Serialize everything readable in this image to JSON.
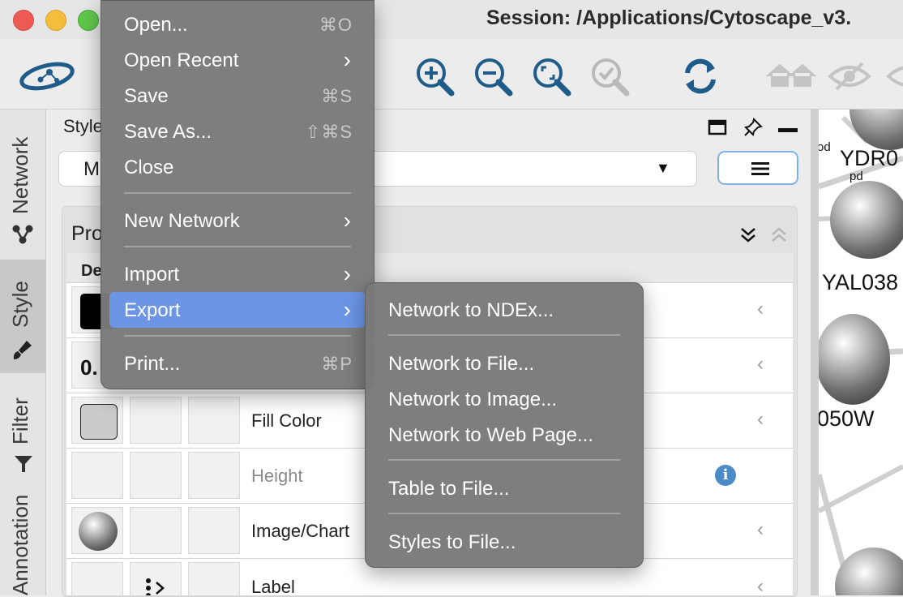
{
  "window": {
    "title": "Session: /Applications/Cytoscape_v3."
  },
  "file_menu": {
    "items": [
      {
        "label": "Open...",
        "shortcut": "⌘O"
      },
      {
        "label": "Open Recent",
        "submenu": true
      },
      {
        "label": "Save",
        "shortcut": "⌘S"
      },
      {
        "label": "Save As...",
        "shortcut": "⇧⌘S"
      },
      {
        "label": "Close"
      },
      {
        "label": "New Network",
        "submenu": true
      },
      {
        "label": "Import",
        "submenu": true
      },
      {
        "label": "Export",
        "submenu": true,
        "highlighted": true
      },
      {
        "label": "Print...",
        "shortcut": "⌘P"
      }
    ],
    "arrow_glyph": "›"
  },
  "export_submenu": {
    "items": [
      {
        "label": "Network to NDEx..."
      },
      {
        "label": "Network to File..."
      },
      {
        "label": "Network to Image..."
      },
      {
        "label": "Network to Web Page..."
      },
      {
        "label": "Table to File..."
      },
      {
        "label": "Styles to File..."
      }
    ]
  },
  "left_tabs": [
    {
      "label": "Network",
      "icon": "network-icon"
    },
    {
      "label": "Style",
      "icon": "brush-icon",
      "active": true
    },
    {
      "label": "Filter",
      "icon": "filter-icon"
    },
    {
      "label": "Annotation",
      "icon": "annotation-icon"
    }
  ],
  "style_panel": {
    "title": "Style",
    "selected_style": "M",
    "dropdown_arrow": "▼",
    "properties_label": "Pro",
    "column_header": "De",
    "rows": [
      {
        "label": "",
        "default_preview": "black-swatch"
      },
      {
        "label": "",
        "default_preview_text": "0."
      },
      {
        "label": "Fill Color",
        "default_preview": "gray-swatch"
      },
      {
        "label": "Height",
        "disabled": true,
        "info": true
      },
      {
        "label": "Image/Chart",
        "default_preview": "sphere"
      },
      {
        "label": "Label",
        "default_preview": "label-icon"
      }
    ],
    "row_chevron": "‹",
    "info_glyph": "i"
  },
  "network_canvas": {
    "node_labels": [
      "YDR0",
      "YAL038",
      "050W"
    ],
    "edge_fragments": [
      "od",
      "pd"
    ]
  },
  "colors": {
    "menu_bg": "#7a7a7a",
    "highlight": "#6c95e6",
    "accent_blue": "#1f5c8a"
  }
}
